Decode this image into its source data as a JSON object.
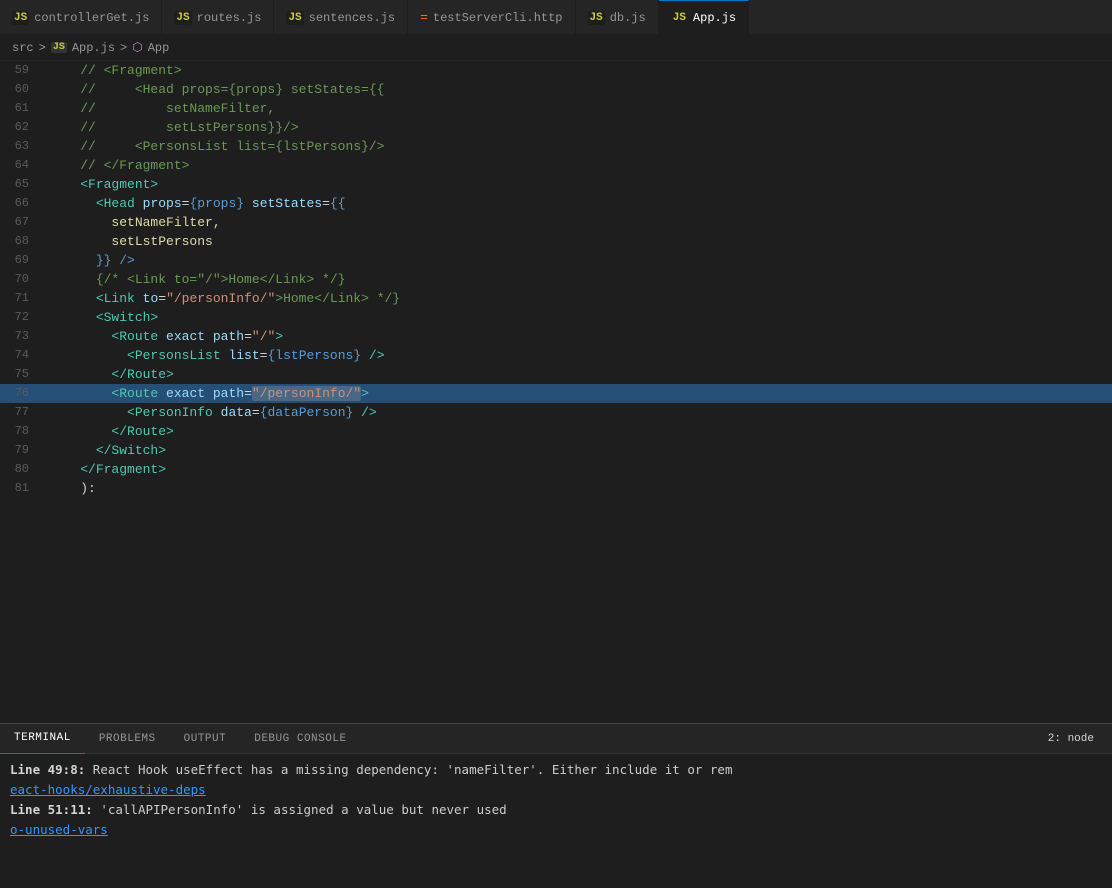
{
  "tabs": [
    {
      "id": "controllerGet",
      "label": "controllerGet.js",
      "type": "js",
      "active": false
    },
    {
      "id": "routes",
      "label": "routes.js",
      "type": "js",
      "active": false
    },
    {
      "id": "sentences",
      "label": "sentences.js",
      "type": "js",
      "active": false
    },
    {
      "id": "testServerCli",
      "label": "testServerCli.http",
      "type": "http",
      "active": false
    },
    {
      "id": "db",
      "label": "db.js",
      "type": "js",
      "active": false
    },
    {
      "id": "App",
      "label": "App.js",
      "type": "js",
      "active": true
    }
  ],
  "breadcrumb": {
    "src": "src",
    "sep1": ">",
    "file": "App.js",
    "sep2": ">",
    "component": "App"
  },
  "lines": [
    {
      "num": 59,
      "tokens": [
        {
          "t": "    // <Fragment>",
          "c": "c-comment"
        }
      ]
    },
    {
      "num": 60,
      "tokens": [
        {
          "t": "    //     <Head props={props} setStates={{",
          "c": "c-comment"
        }
      ]
    },
    {
      "num": 61,
      "tokens": [
        {
          "t": "    //         setNameFilter,",
          "c": "c-comment"
        }
      ]
    },
    {
      "num": 62,
      "tokens": [
        {
          "t": "    //         setLstPersons}}/>",
          "c": "c-comment"
        }
      ]
    },
    {
      "num": 63,
      "tokens": [
        {
          "t": "    //     <PersonsList list={lstPersons}/>",
          "c": "c-comment"
        }
      ]
    },
    {
      "num": 64,
      "tokens": [
        {
          "t": "    // </Fragment>",
          "c": "c-comment"
        }
      ]
    },
    {
      "num": 65,
      "tokens": [
        {
          "t": "    ",
          "c": ""
        },
        {
          "t": "<Fragment>",
          "c": "c-tag"
        }
      ]
    },
    {
      "num": 66,
      "tokens": [
        {
          "t": "      ",
          "c": ""
        },
        {
          "t": "<Head",
          "c": "c-tag"
        },
        {
          "t": " ",
          "c": ""
        },
        {
          "t": "props",
          "c": "c-attr"
        },
        {
          "t": "=",
          "c": "c-punct"
        },
        {
          "t": "{props}",
          "c": "c-jsx-expr"
        },
        {
          "t": " ",
          "c": ""
        },
        {
          "t": "setStates",
          "c": "c-attr"
        },
        {
          "t": "=",
          "c": "c-punct"
        },
        {
          "t": "{{",
          "c": "c-jsx-expr"
        }
      ]
    },
    {
      "num": 67,
      "tokens": [
        {
          "t": "        ",
          "c": ""
        },
        {
          "t": "setNameFilter,",
          "c": "c-yellow"
        }
      ]
    },
    {
      "num": 68,
      "tokens": [
        {
          "t": "        ",
          "c": ""
        },
        {
          "t": "setLstPersons",
          "c": "c-yellow"
        }
      ]
    },
    {
      "num": 69,
      "tokens": [
        {
          "t": "      ",
          "c": ""
        },
        {
          "t": "}} />",
          "c": "c-jsx-expr"
        }
      ]
    },
    {
      "num": 70,
      "tokens": [
        {
          "t": "      ",
          "c": ""
        },
        {
          "t": "{/* <Link to=\"/\">Home</Link> */}",
          "c": "c-comment"
        }
      ]
    },
    {
      "num": 71,
      "tokens": [
        {
          "t": "      ",
          "c": ""
        },
        {
          "t": "<Link",
          "c": "c-tag"
        },
        {
          "t": " ",
          "c": ""
        },
        {
          "t": "to",
          "c": "c-attr"
        },
        {
          "t": "=",
          "c": "c-punct"
        },
        {
          "t": "\"/personInfo/\"",
          "c": "c-string"
        },
        {
          "t": ">Home</Link> */}",
          "c": "c-comment"
        }
      ]
    },
    {
      "num": 72,
      "tokens": [
        {
          "t": "      ",
          "c": ""
        },
        {
          "t": "<Switch>",
          "c": "c-tag"
        }
      ]
    },
    {
      "num": 73,
      "tokens": [
        {
          "t": "        ",
          "c": ""
        },
        {
          "t": "<Route",
          "c": "c-tag"
        },
        {
          "t": " ",
          "c": ""
        },
        {
          "t": "exact",
          "c": "c-attr"
        },
        {
          "t": " ",
          "c": ""
        },
        {
          "t": "path",
          "c": "c-attr"
        },
        {
          "t": "=",
          "c": "c-punct"
        },
        {
          "t": "\"/\"",
          "c": "c-string"
        },
        {
          "t": ">",
          "c": "c-tag"
        }
      ]
    },
    {
      "num": 74,
      "tokens": [
        {
          "t": "          ",
          "c": ""
        },
        {
          "t": "<PersonsList",
          "c": "c-tag"
        },
        {
          "t": " ",
          "c": ""
        },
        {
          "t": "list",
          "c": "c-attr"
        },
        {
          "t": "=",
          "c": "c-punct"
        },
        {
          "t": "{lstPersons}",
          "c": "c-jsx-expr"
        },
        {
          "t": " />",
          "c": "c-tag"
        }
      ]
    },
    {
      "num": 75,
      "tokens": [
        {
          "t": "        ",
          "c": ""
        },
        {
          "t": "</Route>",
          "c": "c-tag"
        }
      ]
    },
    {
      "num": 76,
      "tokens": [
        {
          "t": "        ",
          "c": ""
        },
        {
          "t": "<Route",
          "c": "c-tag"
        },
        {
          "t": " ",
          "c": ""
        },
        {
          "t": "exact",
          "c": "c-attr"
        },
        {
          "t": " ",
          "c": ""
        },
        {
          "t": "path",
          "c": "c-attr"
        },
        {
          "t": "=",
          "c": "c-punct"
        },
        {
          "t": "\"/personInfo/\"",
          "c": "c-string selected-token"
        },
        {
          "t": ">",
          "c": "c-tag"
        }
      ],
      "highlighted": true
    },
    {
      "num": 77,
      "tokens": [
        {
          "t": "          ",
          "c": ""
        },
        {
          "t": "<PersonInfo",
          "c": "c-tag"
        },
        {
          "t": " ",
          "c": ""
        },
        {
          "t": "data",
          "c": "c-attr"
        },
        {
          "t": "=",
          "c": "c-punct"
        },
        {
          "t": "{dataPerson}",
          "c": "c-jsx-expr"
        },
        {
          "t": " />",
          "c": "c-tag"
        }
      ]
    },
    {
      "num": 78,
      "tokens": [
        {
          "t": "        ",
          "c": ""
        },
        {
          "t": "</Route>",
          "c": "c-tag"
        }
      ]
    },
    {
      "num": 79,
      "tokens": [
        {
          "t": "      ",
          "c": ""
        },
        {
          "t": "</Switch>",
          "c": "c-tag"
        }
      ]
    },
    {
      "num": 80,
      "tokens": [
        {
          "t": "    ",
          "c": ""
        },
        {
          "t": "</Fragment>",
          "c": "c-tag"
        }
      ]
    },
    {
      "num": 81,
      "tokens": [
        {
          "t": "    ):",
          "c": ""
        }
      ]
    }
  ],
  "terminal": {
    "tabs": [
      {
        "label": "TERMINAL",
        "active": true
      },
      {
        "label": "PROBLEMS",
        "active": false
      },
      {
        "label": "OUTPUT",
        "active": false
      },
      {
        "label": "DEBUG CONSOLE",
        "active": false
      }
    ],
    "node_badge": "2: node",
    "lines": [
      {
        "parts": [
          {
            "text": "Line 49:8:",
            "class": "term-bold"
          },
          {
            "text": "  React Hook useEffect has a missing dependency: 'nameFilter'. Either include it or rem",
            "class": "term-normal"
          }
        ]
      },
      {
        "parts": [
          {
            "text": "eact-hooks/exhaustive-deps",
            "class": "term-link"
          }
        ]
      },
      {
        "parts": [
          {
            "text": "Line 51:11:",
            "class": "term-bold"
          },
          {
            "text": "  'callAPIPersonInfo' is assigned a value but never used",
            "class": "term-normal"
          }
        ]
      },
      {
        "parts": [
          {
            "text": "o-unused-vars",
            "class": "term-link"
          }
        ]
      }
    ]
  }
}
